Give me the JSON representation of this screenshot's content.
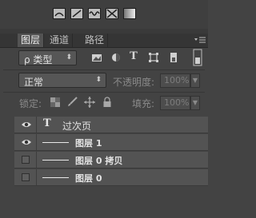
{
  "toolbar": {
    "icons": [
      "warp-icon",
      "skew-icon",
      "wave-icon",
      "crossed-box-icon",
      "gradient-box-icon"
    ]
  },
  "tabs": [
    {
      "label": "图层",
      "active": true
    },
    {
      "label": "通道",
      "active": false
    },
    {
      "label": "路径",
      "active": false
    }
  ],
  "filter": {
    "kind_label": "ρ 类型",
    "icons": [
      "image-filter-icon",
      "adjustment-filter-icon",
      "type-filter-icon",
      "shape-filter-icon",
      "smart-object-filter-icon"
    ],
    "type_glyph": "T"
  },
  "blend": {
    "mode": "正常",
    "opacity_label": "不透明度:",
    "opacity_value": "100%"
  },
  "lock": {
    "label": "锁定:",
    "fill_label": "填充:",
    "fill_value": "100%"
  },
  "layers": [
    {
      "name": "过次页",
      "kind": "text",
      "visible": true,
      "glyph": "T"
    },
    {
      "name": "图层 1",
      "kind": "line",
      "visible": true
    },
    {
      "name": "图层 0 拷贝",
      "kind": "line",
      "visible": false
    },
    {
      "name": "图层 0",
      "kind": "line",
      "visible": false
    }
  ]
}
